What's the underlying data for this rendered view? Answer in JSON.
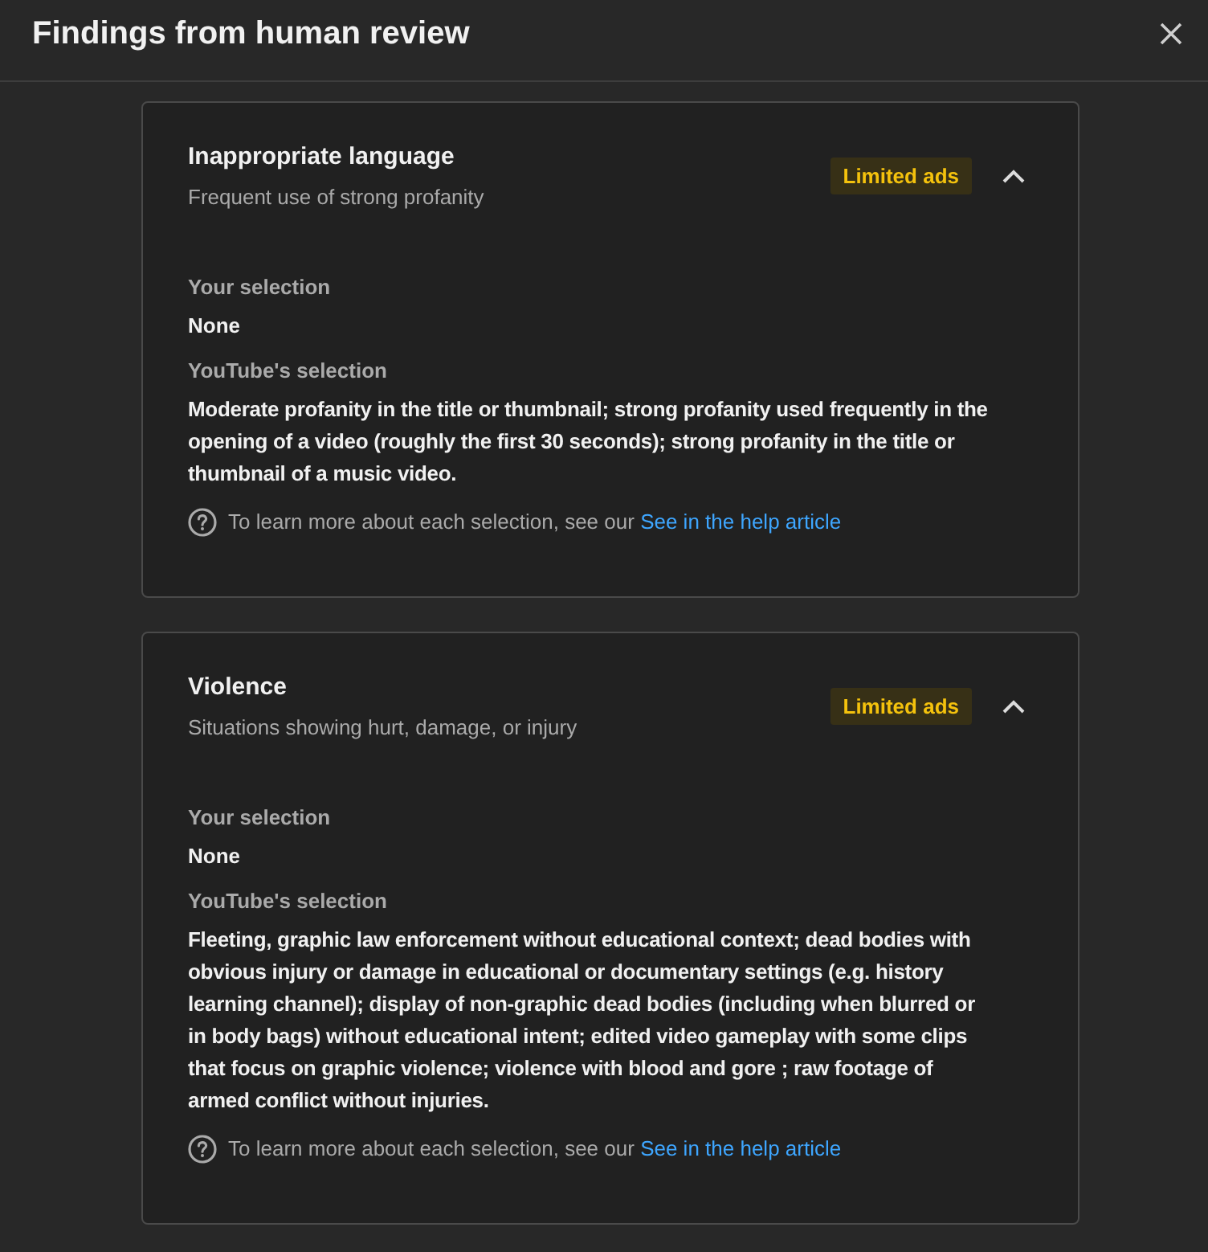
{
  "dialog": {
    "title": "Findings from human review"
  },
  "findings": [
    {
      "title": "Inappropriate language",
      "subtitle": "Frequent use of strong profanity",
      "badge": "Limited ads",
      "expanded": true,
      "your_selection_label": "Your selection",
      "your_selection": "None",
      "youtube_selection_label": "YouTube's selection",
      "youtube_selection": "Moderate profanity in the title or thumbnail; strong profanity used frequently in the opening of a video (roughly the first 30 seconds); strong profanity in the title or thumbnail of a music video.",
      "help_text": "To learn more about each selection, see our",
      "help_link": "See in the help article"
    },
    {
      "title": "Violence",
      "subtitle": "Situations showing hurt, damage, or injury",
      "badge": "Limited ads",
      "expanded": true,
      "your_selection_label": "Your selection",
      "your_selection": "None",
      "youtube_selection_label": "YouTube's selection",
      "youtube_selection": "Fleeting, graphic law enforcement without educational context; dead bodies with obvious injury or damage in educational or documentary settings (e.g. history learning channel); display of non-graphic dead bodies (including when blurred or in body bags) without educational intent; edited video gameplay with some clips that focus on graphic violence; violence with blood and gore ; raw footage of armed conflict without injuries.",
      "help_text": "To learn more about each selection, see our",
      "help_link": "See in the help article"
    }
  ]
}
